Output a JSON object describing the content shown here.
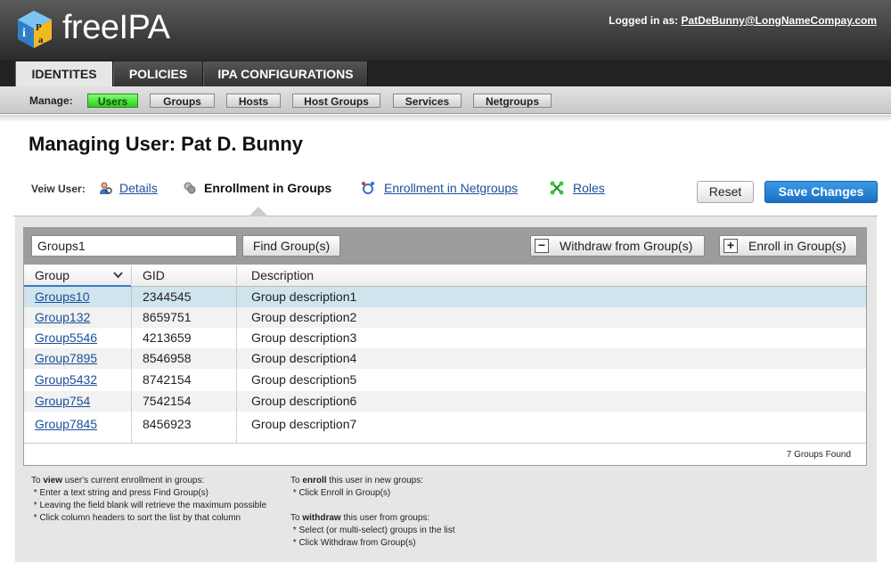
{
  "app": {
    "logo_text": "freeIPA",
    "logged_in_label": "Logged in as:",
    "user_email": "PatDeBunny@LongNameCompay.com"
  },
  "main_tabs": [
    {
      "label": "IDENTITES",
      "active": true
    },
    {
      "label": "POLICIES",
      "active": false
    },
    {
      "label": "IPA CONFIGURATIONS",
      "active": false
    }
  ],
  "subnav": {
    "label": "Manage:",
    "items": [
      {
        "label": "Users",
        "active": true
      },
      {
        "label": "Groups",
        "active": false
      },
      {
        "label": "Hosts",
        "active": false
      },
      {
        "label": "Host Groups",
        "active": false
      },
      {
        "label": "Services",
        "active": false
      },
      {
        "label": "Netgroups",
        "active": false
      }
    ]
  },
  "page_title": "Managing User: Pat D. Bunny",
  "view": {
    "label": "Veiw User:",
    "links": [
      {
        "label": "Details",
        "icon": "user-search-icon"
      },
      {
        "label": "Enrollment in Groups",
        "icon": "group-icon",
        "current": true
      },
      {
        "label": "Enrollment in Netgroups",
        "icon": "netgroup-icon"
      },
      {
        "label": "Roles",
        "icon": "roles-icon"
      }
    ],
    "reset_label": "Reset",
    "save_label": "Save Changes"
  },
  "toolbar": {
    "search_value": "Groups1",
    "find_label": "Find Group(s)",
    "withdraw_label": "Withdraw from Group(s)",
    "enroll_label": "Enroll in Group(s)"
  },
  "table": {
    "columns": [
      "Group",
      "GID",
      "Description"
    ],
    "rows": [
      {
        "group": "Groups10",
        "gid": "2344545",
        "desc": "Group description1",
        "selected": true
      },
      {
        "group": "Group132",
        "gid": "8659751",
        "desc": "Group description2"
      },
      {
        "group": "Group5546",
        "gid": "4213659",
        "desc": "Group description3"
      },
      {
        "group": "Group7895",
        "gid": "8546958",
        "desc": "Group description4"
      },
      {
        "group": "Group5432",
        "gid": "8742154",
        "desc": "Group description5"
      },
      {
        "group": "Group754",
        "gid": "7542154",
        "desc": "Group description6"
      },
      {
        "group": "Group7845",
        "gid": "8456923",
        "desc": "Group description7"
      }
    ],
    "count_text": "7 Groups Found"
  },
  "help": {
    "view_title_pre": "To ",
    "view_title_bold": "view",
    "view_title_post": " user's current enrollment in groups:",
    "view_items": [
      " * Enter a text string and press Find Group(s)",
      " * Leaving the field blank will retrieve the maximum possible",
      " * Click column headers to sort the list by that column"
    ],
    "enroll_title_pre": "To ",
    "enroll_title_bold": "enroll",
    "enroll_title_post": " this user in new groups:",
    "enroll_items": [
      " * Click Enroll in Group(s)"
    ],
    "withdraw_title_pre": "To ",
    "withdraw_title_bold": "withdraw",
    "withdraw_title_post": " this user from groups:",
    "withdraw_items": [
      " * Select (or multi-select) groups in the list",
      " * Click Withdraw from Group(s)"
    ]
  }
}
